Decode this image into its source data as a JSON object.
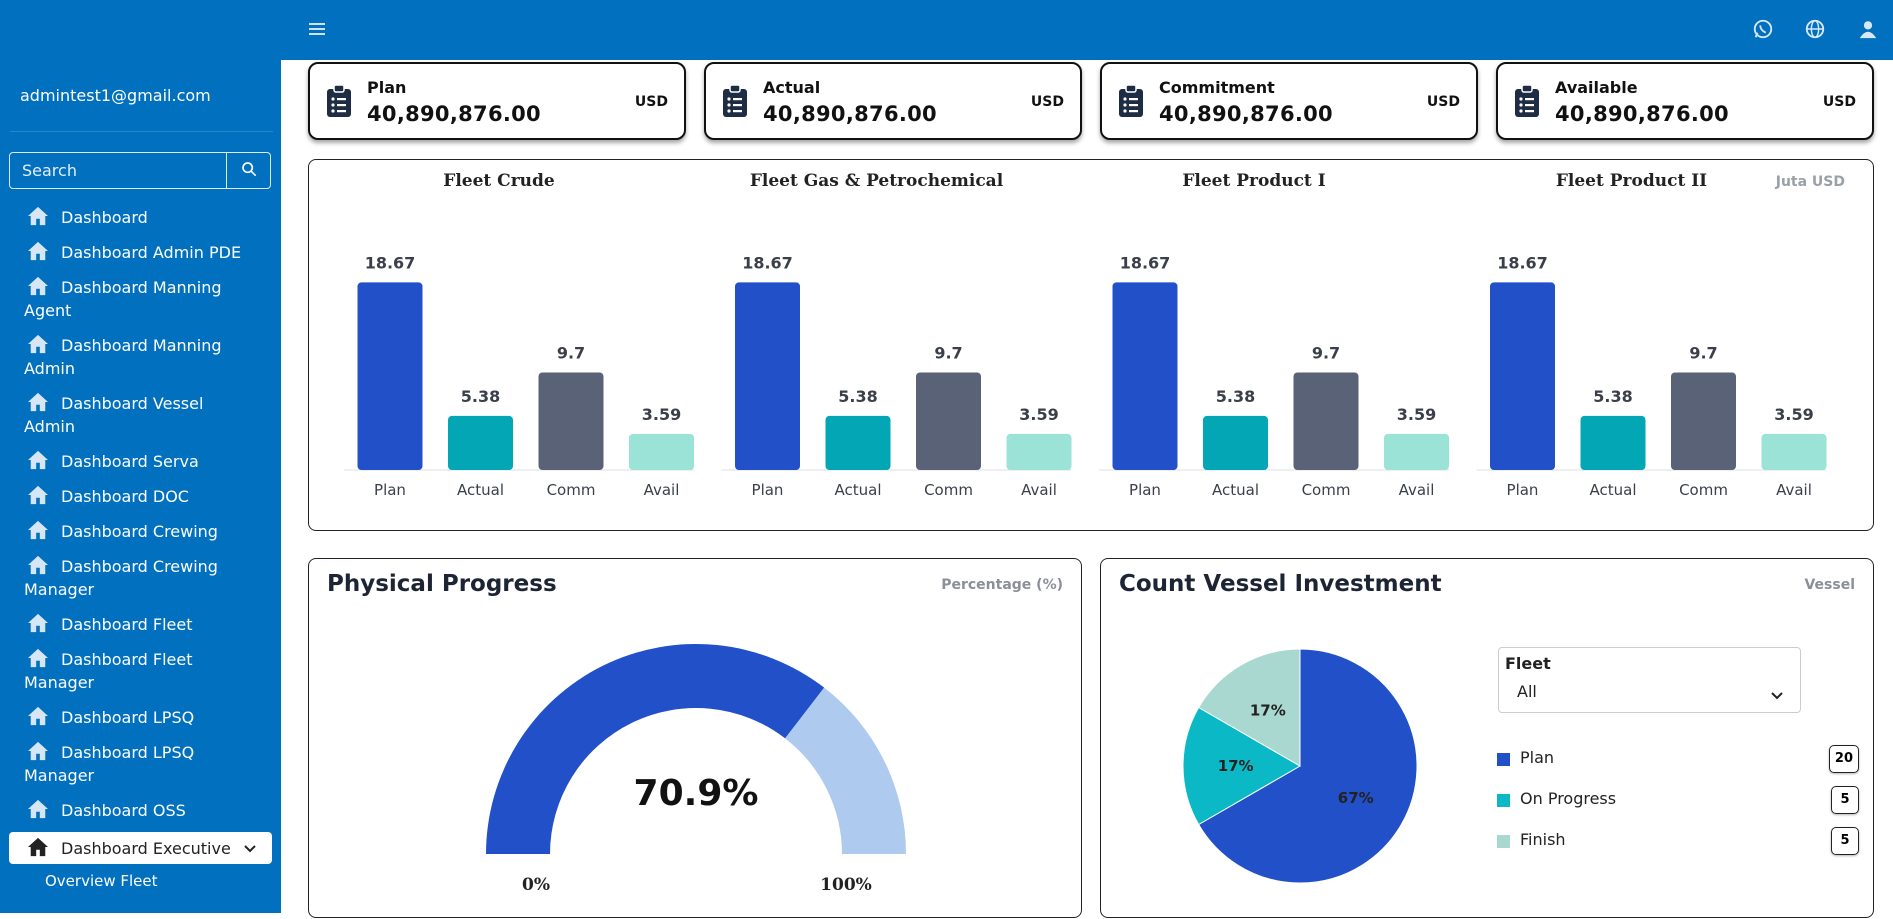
{
  "topbar": {
    "menu_icon": "hamburger-icon",
    "icons": [
      "whatsapp-icon",
      "globe-icon",
      "user-icon"
    ]
  },
  "sidebar": {
    "user_email": "admintest1@gmail.com",
    "search": {
      "placeholder": "Search",
      "icon": "search-icon"
    },
    "items": [
      {
        "line1": "Dashboard",
        "line2": ""
      },
      {
        "line1": "Dashboard Admin PDE",
        "line2": ""
      },
      {
        "line1": "Dashboard Manning",
        "line2": "Agent"
      },
      {
        "line1": "Dashboard Manning",
        "line2": "Admin"
      },
      {
        "line1": "Dashboard Vessel",
        "line2": "Admin"
      },
      {
        "line1": "Dashboard Serva",
        "line2": ""
      },
      {
        "line1": "Dashboard DOC",
        "line2": ""
      },
      {
        "line1": "Dashboard Crewing",
        "line2": ""
      },
      {
        "line1": "Dashboard Crewing",
        "line2": "Manager"
      },
      {
        "line1": "Dashboard Fleet",
        "line2": ""
      },
      {
        "line1": "Dashboard Fleet",
        "line2": "Manager"
      },
      {
        "line1": "Dashboard LPSQ",
        "line2": ""
      },
      {
        "line1": "Dashboard LPSQ",
        "line2": "Manager"
      },
      {
        "line1": "Dashboard OSS",
        "line2": ""
      }
    ],
    "active_item": "Dashboard Executive",
    "sub_item": "Overview Fleet"
  },
  "summary_cards": [
    {
      "label": "Plan",
      "value": "40,890,876.00",
      "unit": "USD"
    },
    {
      "label": "Actual",
      "value": "40,890,876.00",
      "unit": "USD"
    },
    {
      "label": "Commitment",
      "value": "40,890,876.00",
      "unit": "USD"
    },
    {
      "label": "Available",
      "value": "40,890,876.00",
      "unit": "USD"
    }
  ],
  "fleet_chart": {
    "unit_label": "Juta USD",
    "colors": [
      "#2250c9",
      "#02a6b4",
      "#5a6278",
      "#9be3d6"
    ]
  },
  "chart_data": [
    {
      "type": "bar",
      "title": "Fleet Crude",
      "categories": [
        "Plan",
        "Actual",
        "Comm",
        "Avail"
      ],
      "values": [
        18.67,
        5.38,
        9.7,
        3.59
      ],
      "ylim": [
        0,
        20
      ]
    },
    {
      "type": "bar",
      "title": "Fleet Gas & Petrochemical",
      "categories": [
        "Plan",
        "Actual",
        "Comm",
        "Avail"
      ],
      "values": [
        18.67,
        5.38,
        9.7,
        3.59
      ],
      "ylim": [
        0,
        20
      ]
    },
    {
      "type": "bar",
      "title": "Fleet Product I",
      "categories": [
        "Plan",
        "Actual",
        "Comm",
        "Avail"
      ],
      "values": [
        18.67,
        5.38,
        9.7,
        3.59
      ],
      "ylim": [
        0,
        20
      ]
    },
    {
      "type": "bar",
      "title": "Fleet Product II",
      "categories": [
        "Plan",
        "Actual",
        "Comm",
        "Avail"
      ],
      "values": [
        18.67,
        5.38,
        9.7,
        3.59
      ],
      "ylim": [
        0,
        20
      ]
    },
    {
      "type": "gauge",
      "value": 70.9,
      "value_label": "70.9%",
      "min_label": "0%",
      "max_label": "100%",
      "colors": {
        "fill": "#2250c9",
        "rest": "#aecaef"
      }
    },
    {
      "type": "pie",
      "labels": [
        "Plan",
        "On Progress",
        "Finish"
      ],
      "values": [
        20,
        5,
        5
      ],
      "percent_labels": [
        "67%",
        "17%",
        "17%"
      ],
      "colors": [
        "#2250c9",
        "#0bb9c6",
        "#a8d8d0"
      ]
    }
  ],
  "physical_progress": {
    "title": "Physical Progress",
    "unit": "Percentage (%)"
  },
  "vessel_investment": {
    "title": "Count Vessel Investment",
    "unit": "Vessel",
    "filter": {
      "label": "Fleet",
      "value": "All"
    },
    "legend": [
      {
        "label": "Plan",
        "count": "20",
        "color": "#2250c9"
      },
      {
        "label": "On Progress",
        "count": "5",
        "color": "#0bb9c6"
      },
      {
        "label": "Finish",
        "count": "5",
        "color": "#a8d8d0"
      }
    ]
  }
}
